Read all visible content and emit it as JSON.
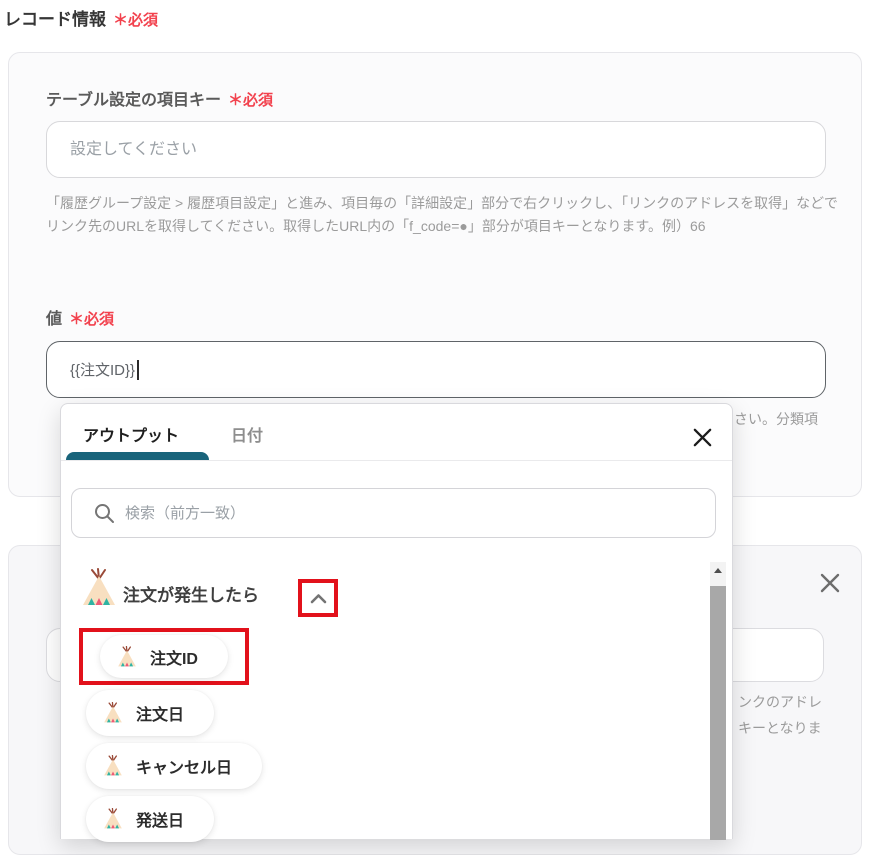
{
  "page": {
    "title": "レコード情報",
    "required_label": "＊必須"
  },
  "record_card": {
    "field1": {
      "label": "テーブル設定の項目キー",
      "required": "＊必須",
      "placeholder": "設定してください",
      "help": "「履歴グループ設定 > 履歴項目設定」と進み、項目毎の「詳細設定」部分で右クリックし、「リンクのアドレスを取得」などでリンク先のURLを取得してください。取得したURL内の「f_code=●」部分が項目キーとなります。例）66"
    },
    "field2": {
      "label": "値",
      "required": "＊必須",
      "value": "{{注文ID}}",
      "help_fragment": "さい。分類項"
    }
  },
  "dropdown": {
    "tabs": [
      {
        "label": "アウトプット",
        "active": true
      },
      {
        "label": "日付",
        "active": false
      }
    ],
    "search_placeholder": "検索（前方一致）",
    "group": {
      "label": "注文が発生したら",
      "icon": "tent-icon",
      "collapse_icon": "chevron-up-icon"
    },
    "items": [
      {
        "label": "注文ID",
        "icon": "tent-icon",
        "highlighted": true
      },
      {
        "label": "注文日",
        "icon": "tent-icon",
        "highlighted": false
      },
      {
        "label": "キャンセル日",
        "icon": "tent-icon",
        "highlighted": false
      },
      {
        "label": "発送日",
        "icon": "tent-icon",
        "highlighted": false
      }
    ]
  },
  "second_card": {
    "help_fragments": [
      "ンクのアドレ",
      "キーとなりま"
    ]
  },
  "colors": {
    "accent_teal": "#19647b",
    "required_red": "#f2424e",
    "annotation_red": "#e2111b",
    "tent_body": "#f8dfc0",
    "tent_pole": "#9a4a38",
    "tent_teal": "#2fb3a3",
    "tent_pink": "#ee5b76"
  }
}
